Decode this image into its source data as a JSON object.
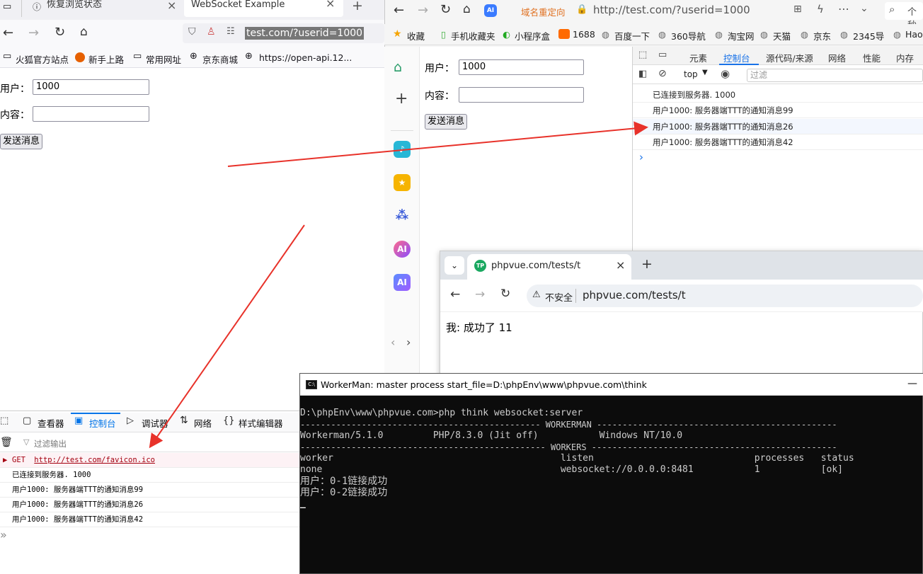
{
  "firefox": {
    "tabs": [
      {
        "label": "恢复浏览状态"
      },
      {
        "label": "WebSocket Example"
      }
    ],
    "url": "test.com/?userid=1000",
    "bookmarks": [
      "火狐官方站点",
      "新手上路",
      "常用网址",
      "京东商城",
      "https://open-api.12..."
    ],
    "page": {
      "user_label": "用户：",
      "user_value": "1000",
      "content_label": "内容：",
      "content_value": "",
      "send_label": "发送消息"
    },
    "devtools": {
      "tabs": [
        "查看器",
        "控制台",
        "调试器",
        "网络",
        "样式编辑器"
      ],
      "filter_placeholder": "过滤输出",
      "get_method": "GET",
      "get_url": "http://test.com/favicon.ico",
      "lines": [
        "已连接到服务器. 1000",
        "用户1000: 服务器端TTT的通知消息99",
        "用户1000: 服务器端TTT的通知消息26",
        "用户1000: 服务器端TTT的通知消息42"
      ],
      "prompt": "»"
    }
  },
  "browser2": {
    "redirect_label": "域名重定向",
    "url": "http://test.com/?userid=1000",
    "bookmarks": [
      "收藏",
      "手机收藏夹",
      "小程序盒",
      "1688",
      "百度一下",
      "360导航",
      "淘宝网",
      "天猫",
      "京东",
      "2345导",
      "Hao"
    ],
    "search_text": "个秒",
    "page": {
      "user_label": "用户：",
      "user_value": "1000",
      "content_label": "内容：",
      "content_value": "",
      "send_label": "发送消息"
    },
    "devtools": {
      "tabs": [
        "元素",
        "控制台",
        "源代码/来源",
        "网络",
        "性能",
        "内存"
      ],
      "context": "top",
      "filter_placeholder": "过滤",
      "lines": [
        "已连接到服务器. 1000",
        "用户1000: 服务器端TTT的通知消息99",
        "用户1000: 服务器端TTT的通知消息26",
        "用户1000: 服务器端TTT的通知消息42"
      ],
      "prompt": "›"
    },
    "sidebar_ai": "AI"
  },
  "chrome": {
    "tab_title": "phpvue.com/tests/t",
    "favicon": "TP",
    "insecure_label": "不安全",
    "url": "phpvue.com/tests/t",
    "body_text": "我: 成功了 11"
  },
  "terminal": {
    "title": "WorkerMan: master process  start_file=D:\\phpEnv\\www\\phpvue.com\\think",
    "minimize": "—",
    "lines": [
      "D:\\phpEnv\\www\\phpvue.com>php think websocket:server",
      "----------------------------------------------- WORKERMAN -----------------------------------------------",
      "Workerman/5.1.0         PHP/8.3.0 (Jit off)           Windows NT/10.0",
      "------------------------------------------------ WORKERS ------------------------------------------------",
      "worker                                         listen                             processes   status",
      "none                                           websocket://0.0.0.0:8481           1           [ok]",
      "用户：0-1链接成功",
      "用户：0-2链接成功"
    ],
    "cursor": "_"
  },
  "colors": {
    "arrow": "#e8322a",
    "firefox_accent": "#0074e8",
    "chrome_accent": "#1a73e8",
    "terminal_bg": "#0c0c0c"
  }
}
